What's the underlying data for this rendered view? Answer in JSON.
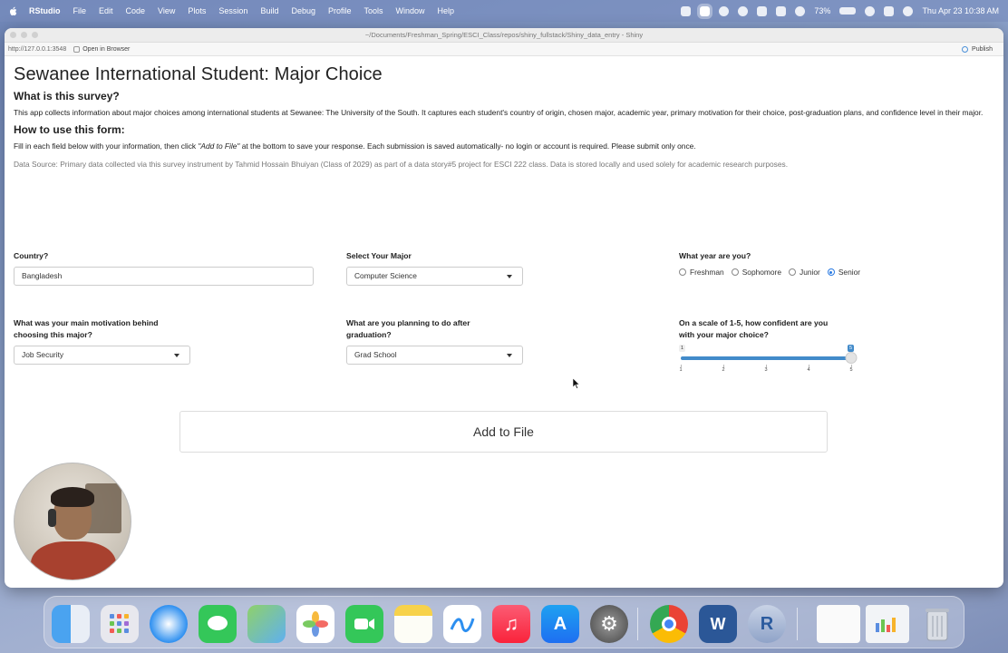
{
  "menubar": {
    "app_name": "RStudio",
    "items": [
      "File",
      "Edit",
      "Code",
      "View",
      "Plots",
      "Session",
      "Build",
      "Debug",
      "Profile",
      "Tools",
      "Window",
      "Help"
    ],
    "battery": "73%",
    "clock": "Thu Apr 23  10:38 AM"
  },
  "window": {
    "title": "~/Documents/Freshman_Spring/ESCI_Class/repos/shiny_fullstack/Shiny_data_entry - Shiny",
    "url": "http://127.0.0.1:3548",
    "open_in_browser": "Open in Browser",
    "publish": "Publish"
  },
  "app": {
    "title": "Sewanee International Student: Major Choice",
    "what_heading": "What is this survey?",
    "what_text": "This app collects information about major choices among international students at Sewanee: The University of the South. It captures each student's country of origin, chosen major, academic year, primary motivation for their choice, post-graduation plans, and confidence level in their major.",
    "how_heading": "How to use this form:",
    "how_text_before": "Fill in each field below with your information, then click ",
    "how_text_em": "\"Add to File\"",
    "how_text_after": " at the bottom to save your response. Each submission is saved automatically- no login or account is required. Please submit only once.",
    "data_source": "Data Source: Primary data collected via this survey instrument by Tahmid Hossain Bhuiyan (Class of 2029) as part of a data story#5 project for ESCI 222 class. Data is stored locally and used solely for academic research purposes.",
    "country": {
      "label": "Country?",
      "value": "Bangladesh"
    },
    "major": {
      "label": "Select Your Major",
      "value": "Computer Science"
    },
    "year": {
      "label": "What year are you?",
      "options": [
        "Freshman",
        "Sophomore",
        "Junior",
        "Senior"
      ],
      "selected": "Senior"
    },
    "motivation": {
      "label_line1": "What was your main motivation behind",
      "label_line2": "choosing this major?",
      "value": "Job Security"
    },
    "plans": {
      "label_line1": "What are you planning to do after",
      "label_line2": "graduation?",
      "value": "Grad School"
    },
    "confidence": {
      "label_line1": "On a scale of 1-5, how confident are you",
      "label_line2": "with your major choice?",
      "min": 1,
      "max": 5,
      "value": 5,
      "min_label": "1",
      "value_label": "5",
      "ticks": [
        "1",
        "2",
        "3",
        "4",
        "5"
      ]
    },
    "add_button": "Add to File"
  },
  "icons": {
    "apple": "apple-icon",
    "cursor": "cursor-icon"
  },
  "colors": {
    "accent": "#428bca",
    "radio_checked": "#2a7ae2"
  },
  "dock": {
    "apps": [
      "Finder",
      "Launchpad",
      "Safari",
      "Messages",
      "Maps",
      "Photos",
      "FaceTime",
      "Notes",
      "Freeform",
      "Music",
      "App Store",
      "System Settings",
      "Google Chrome",
      "Microsoft Word",
      "R",
      "Recent Window 1",
      "Recent Window 2",
      "Trash"
    ]
  }
}
